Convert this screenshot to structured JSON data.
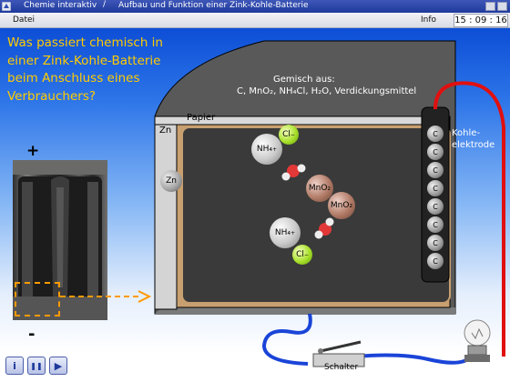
{
  "titlebar": {
    "app_title": "Chemie interaktiv",
    "separator": "/",
    "page_title": "Aufbau und Funktion einer Zink-Kohle-Batterie",
    "icons": [
      "app-icon",
      "minimize-icon",
      "close-icon"
    ]
  },
  "menu": {
    "datei": "Datei",
    "info": "Info",
    "clock": "15 : 09 : 16"
  },
  "question": "Was passiert chemisch in einer Zink-Kohle-Batterie beim Anschluss eines Verbrauchers?",
  "battery_photo": {
    "plus": "+",
    "minus": "-"
  },
  "diagram": {
    "gemisch_heading": "Gemisch aus:",
    "gemisch_list": "C,  MnO₂, NH₄Cl, H₂O, Verdickungsmittel",
    "label_zn": "Zn",
    "label_papier": "Papier",
    "label_kohle_1": "Kohle-",
    "label_kohle_2": "elektrode",
    "zn_ball": "Zn",
    "particles": {
      "nh4": "NH₄",
      "nh4_sup": "+",
      "cl": "Cl",
      "cl_sup": "−",
      "mno2": "MnO₂"
    },
    "carbon_label": "C",
    "carbon_count": 8,
    "switch_label": "Schalter"
  },
  "colors": {
    "question_text": "#ffcc00",
    "wire_red": "#e01010",
    "wire_blue": "#1a44d8",
    "zoom_dash": "#ff9a00"
  },
  "controls": [
    {
      "icon": "info-icon",
      "glyph": "i"
    },
    {
      "icon": "pause-icon",
      "glyph": "❚❚"
    },
    {
      "icon": "play-icon",
      "glyph": "▶"
    }
  ]
}
